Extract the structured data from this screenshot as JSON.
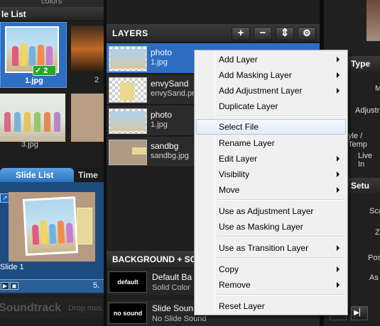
{
  "file_list": {
    "top_label": "colors",
    "header": "le List",
    "thumbs": [
      {
        "label": "1.jpg",
        "badge": "2",
        "selected": true
      },
      {
        "label": "2",
        "selected": false
      },
      {
        "label": "3.jpg",
        "selected": false
      },
      {
        "label": "",
        "selected": false
      }
    ]
  },
  "slide_list": {
    "tab_active": "Slide List",
    "tab_other": "Time",
    "slide_label": "Slide 1",
    "slide_time": "5.",
    "soundtrack_title": "Soundtrack",
    "soundtrack_hint": "Drop mus"
  },
  "layers": {
    "title": "LAYERS",
    "buttons": {
      "add": "+",
      "remove": "−",
      "move": "⇕",
      "settings": "⚙"
    },
    "rows": [
      {
        "name": "photo",
        "file": "1.jpg",
        "selected": true
      },
      {
        "name": "envySand",
        "file": "envySand.pn",
        "selected": false
      },
      {
        "name": "photo",
        "file": "1.jpg",
        "selected": false
      },
      {
        "name": "sandbg",
        "file": "sandbg.jpg",
        "selected": false
      }
    ]
  },
  "background": {
    "header": "BACKGROUND + SO",
    "rows": [
      {
        "box": "default",
        "name": "Default Ba",
        "sub": "Solid Color"
      },
      {
        "box": "no sound",
        "name": "Slide Soun",
        "sub": "No Slide Sound"
      }
    ]
  },
  "right_panel": {
    "header1": "r Type",
    "header2": "r Setu",
    "labels": [
      "M",
      "Adjustn",
      "yle / Temp",
      "Live In",
      "Sca",
      "Z",
      "Pos",
      "As"
    ]
  },
  "context_menu": {
    "items": [
      {
        "label": "Add Layer",
        "submenu": true
      },
      {
        "label": "Add Masking Layer",
        "submenu": true
      },
      {
        "label": "Add Adjustment Layer",
        "submenu": true
      },
      {
        "label": "Duplicate Layer",
        "submenu": false
      },
      {
        "label": "Select File",
        "submenu": false,
        "highlighted": true
      },
      {
        "label": "Rename Layer",
        "submenu": false
      },
      {
        "label": "Edit Layer",
        "submenu": true
      },
      {
        "label": "Visibility",
        "submenu": true
      },
      {
        "label": "Move",
        "submenu": true
      },
      {
        "label": "Use as Adjustment Layer",
        "submenu": false
      },
      {
        "label": "Use as Masking Layer",
        "submenu": false
      },
      {
        "label": "Use as Transition Layer",
        "submenu": true
      },
      {
        "label": "Copy",
        "submenu": true
      },
      {
        "label": "Remove",
        "submenu": true
      },
      {
        "label": "Reset Layer",
        "submenu": false
      }
    ]
  },
  "colors": {
    "selection": "#2e6ec2",
    "badge": "#2aa52a",
    "menu_highlight": "#e2ecf8"
  }
}
